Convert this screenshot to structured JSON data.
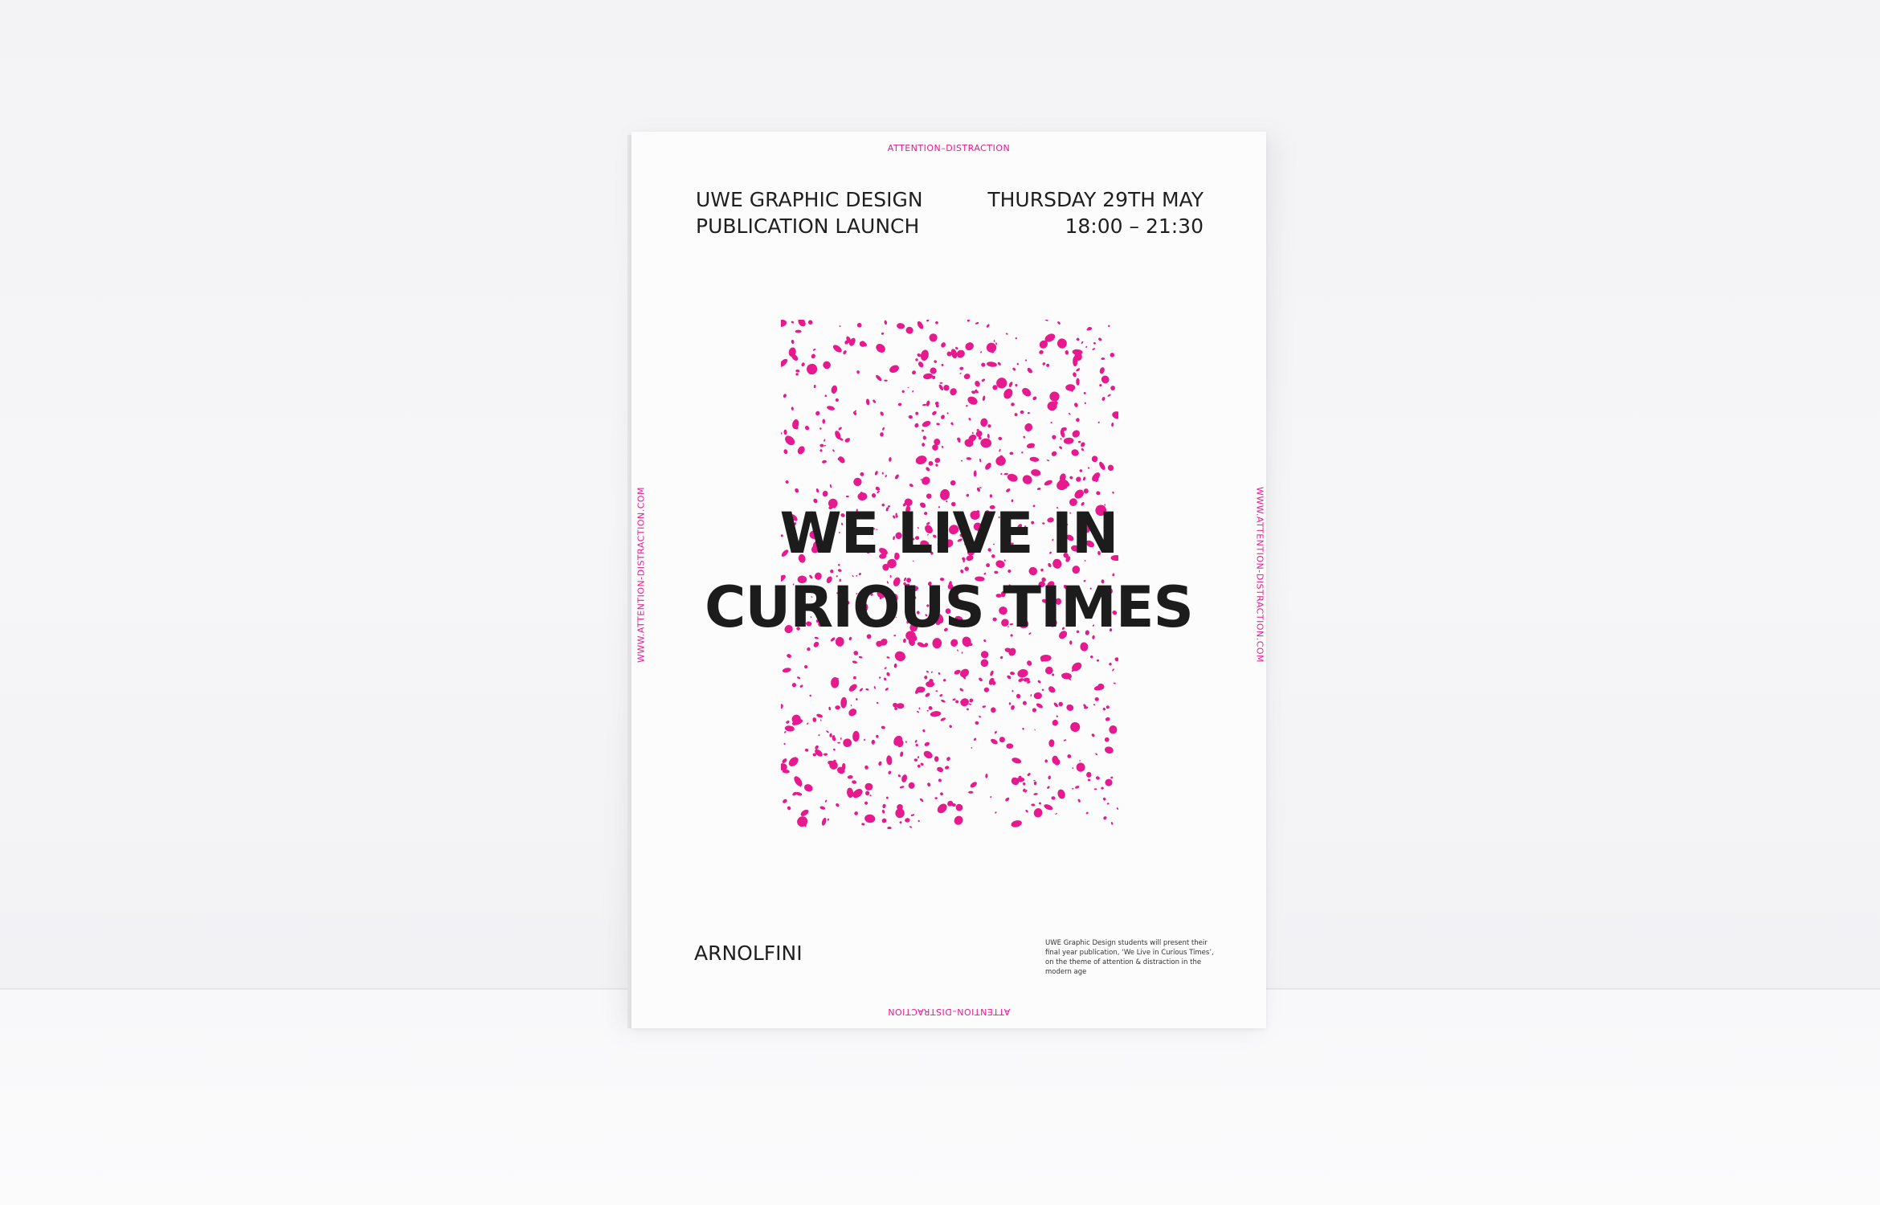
{
  "poster": {
    "top_small_text": "ATTENTION–DISTRACTION",
    "bottom_small_text": "ATTENTION–DISTRACTION",
    "side_left_text": "WWW.ATTENTION-DISTRACTION.COM",
    "side_right_text": "WWW.ATTENTION-DISTRACTION.COM",
    "header_left_line1": "UWE GRAPHIC DESIGN",
    "header_left_line2": "PUBLICATION LAUNCH",
    "header_right_line1": "THURSDAY 29TH MAY",
    "header_right_line2": "18:00 – 21:30",
    "headline_line1": "WE LIVE IN",
    "headline_line2": "CURIOUS TIMES",
    "venue": "ARNOLFINI",
    "blurb": "UWE Graphic Design students will present their final year publication, ‘We Live in Curious Times’, on the theme of attention & distraction in the modern age"
  },
  "colors": {
    "accent": "#e6198f",
    "text": "#1c1c1c",
    "paper": "#fcfcfc",
    "wall": "#f3f3f6"
  }
}
